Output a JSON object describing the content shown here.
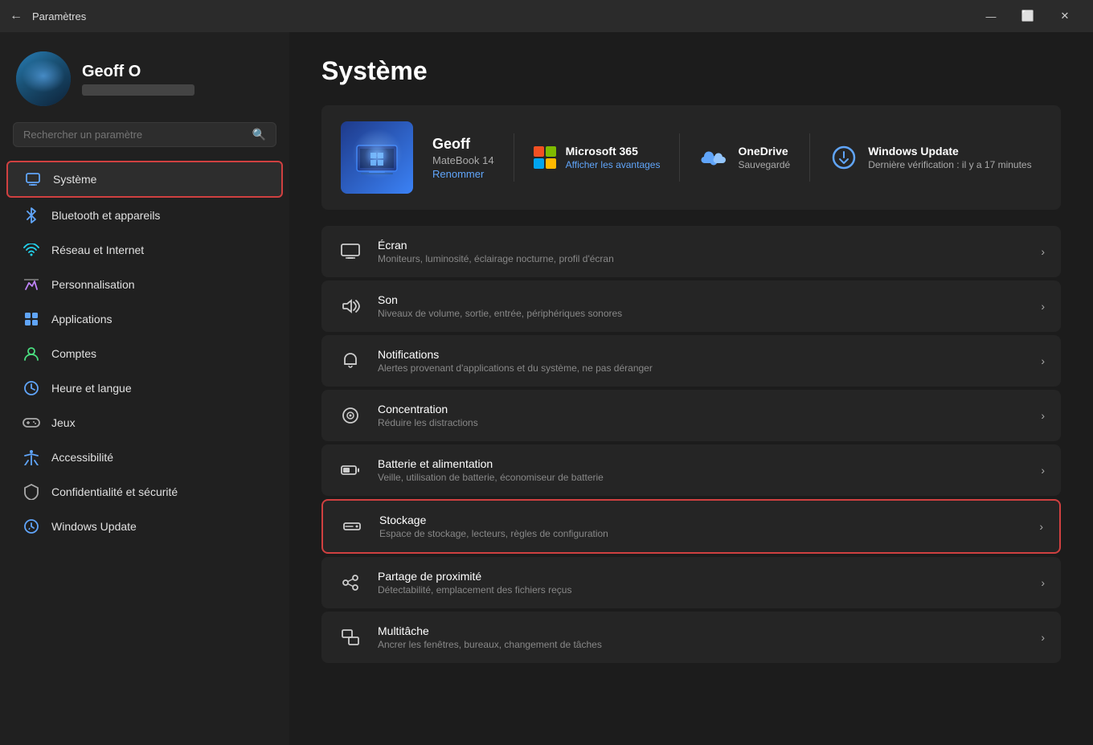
{
  "titlebar": {
    "back_label": "←",
    "title": "Paramètres",
    "minimize": "—",
    "maximize": "⬜",
    "close": "✕"
  },
  "sidebar": {
    "user": {
      "name": "Geoff O",
      "email_placeholder": "••••••••••••"
    },
    "search_placeholder": "Rechercher un paramètre",
    "nav_items": [
      {
        "id": "systeme",
        "label": "Système",
        "active": true
      },
      {
        "id": "bluetooth",
        "label": "Bluetooth et appareils"
      },
      {
        "id": "reseau",
        "label": "Réseau et Internet"
      },
      {
        "id": "perso",
        "label": "Personnalisation"
      },
      {
        "id": "applications",
        "label": "Applications"
      },
      {
        "id": "comptes",
        "label": "Comptes"
      },
      {
        "id": "heure",
        "label": "Heure et langue"
      },
      {
        "id": "jeux",
        "label": "Jeux"
      },
      {
        "id": "accessibilite",
        "label": "Accessibilité"
      },
      {
        "id": "confidentialite",
        "label": "Confidentialité et sécurité"
      },
      {
        "id": "windows-update",
        "label": "Windows Update"
      }
    ]
  },
  "content": {
    "page_title": "Système",
    "device_card": {
      "device_name": "Geoff",
      "device_model": "MateBook 14",
      "rename_label": "Renommer"
    },
    "ms365": {
      "title": "Microsoft 365",
      "subtitle": "Afficher les avantages"
    },
    "onedrive": {
      "title": "OneDrive",
      "subtitle": "Sauvegardé"
    },
    "windows_update": {
      "title": "Windows Update",
      "subtitle": "Dernière vérification : il y a 17 minutes"
    },
    "settings_rows": [
      {
        "id": "ecran",
        "title": "Écran",
        "subtitle": "Moniteurs, luminosité, éclairage nocturne, profil d'écran"
      },
      {
        "id": "son",
        "title": "Son",
        "subtitle": "Niveaux de volume, sortie, entrée, périphériques sonores"
      },
      {
        "id": "notifications",
        "title": "Notifications",
        "subtitle": "Alertes provenant d'applications et du système, ne pas déranger"
      },
      {
        "id": "concentration",
        "title": "Concentration",
        "subtitle": "Réduire les distractions"
      },
      {
        "id": "batterie",
        "title": "Batterie et alimentation",
        "subtitle": "Veille, utilisation de batterie, économiseur de batterie"
      },
      {
        "id": "stockage",
        "title": "Stockage",
        "subtitle": "Espace de stockage, lecteurs, règles de configuration",
        "highlighted": true
      },
      {
        "id": "partage",
        "title": "Partage de proximité",
        "subtitle": "Détectabilité, emplacement des fichiers reçus"
      },
      {
        "id": "multitache",
        "title": "Multitâche",
        "subtitle": "Ancrer les fenêtres, bureaux, changement de tâches"
      }
    ]
  }
}
